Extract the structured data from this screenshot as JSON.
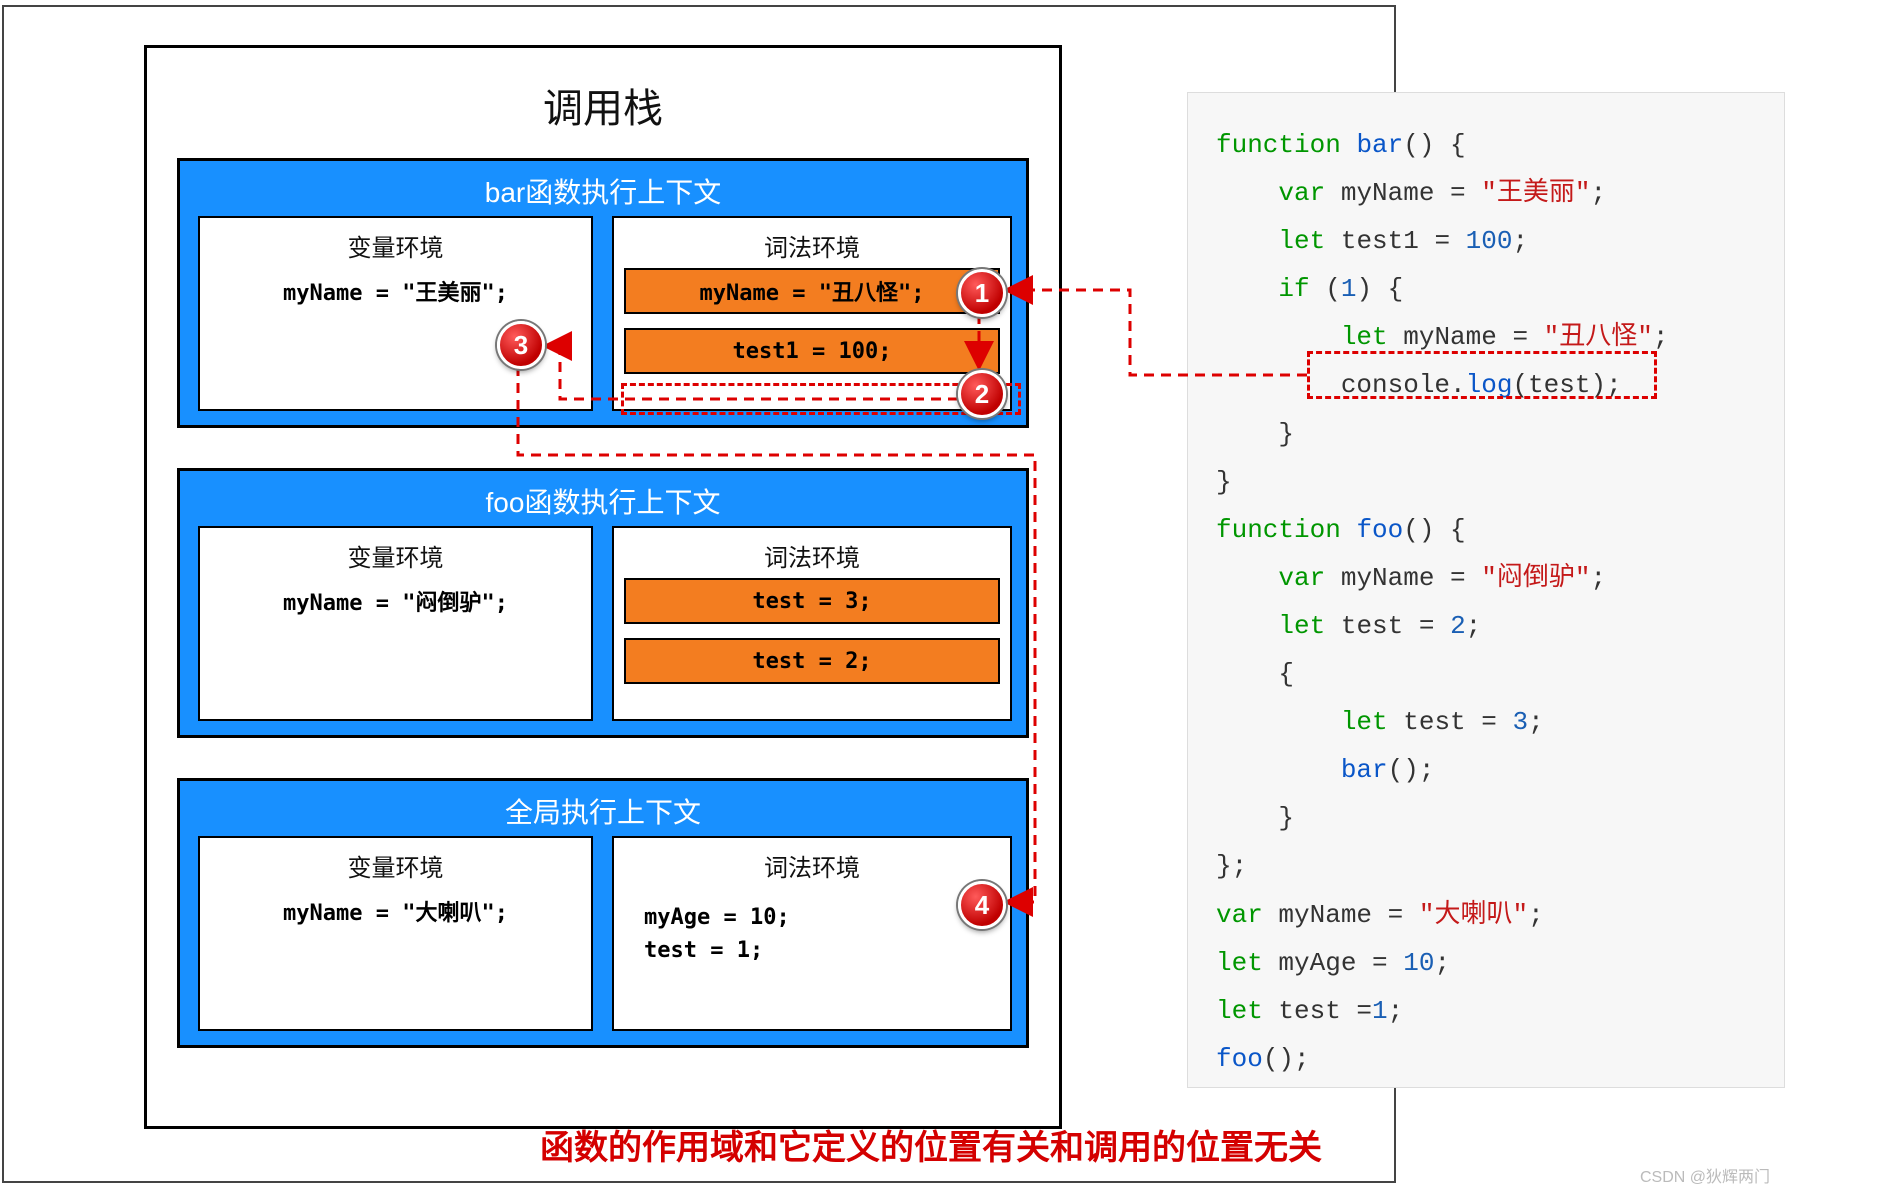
{
  "diagram": {
    "stack_title": "调用栈",
    "contexts": [
      {
        "title": "bar函数执行上下文",
        "var_env": {
          "title": "变量环境",
          "lines": [
            "myName = \"王美丽\";"
          ]
        },
        "lex_env": {
          "title": "词法环境",
          "slots": [
            "myName = \"丑八怪\";",
            "test1 = 100;"
          ]
        }
      },
      {
        "title": "foo函数执行上下文",
        "var_env": {
          "title": "变量环境",
          "lines": [
            "myName = \"闷倒驴\";"
          ]
        },
        "lex_env": {
          "title": "词法环境",
          "slots": [
            "test = 3;",
            "test = 2;"
          ]
        }
      },
      {
        "title": "全局执行上下文",
        "var_env": {
          "title": "变量环境",
          "lines": [
            "myName = \"大喇叭\";"
          ]
        },
        "lex_env": {
          "title": "词法环境",
          "lines": [
            "myAge = 10;",
            "test = 1;"
          ]
        }
      }
    ],
    "badges": {
      "b1": "1",
      "b2": "2",
      "b3": "3",
      "b4": "4"
    }
  },
  "caption": "函数的作用域和它定义的位置有关和调用的位置无关",
  "credit": "CSDN @狄辉两门",
  "code": {
    "bar_fn": "bar",
    "foo_fn": "foo",
    "myName_str1": "\"王美丽\"",
    "test1_num": "100",
    "myName_str2": "\"丑八怪\"",
    "log_arg": "test",
    "myName_str3": "\"闷倒驴\"",
    "test_num2": "2",
    "test_num3": "3",
    "myName_str4": "\"大喇叭\"",
    "myAge_num": "10",
    "test_num1": "1"
  }
}
